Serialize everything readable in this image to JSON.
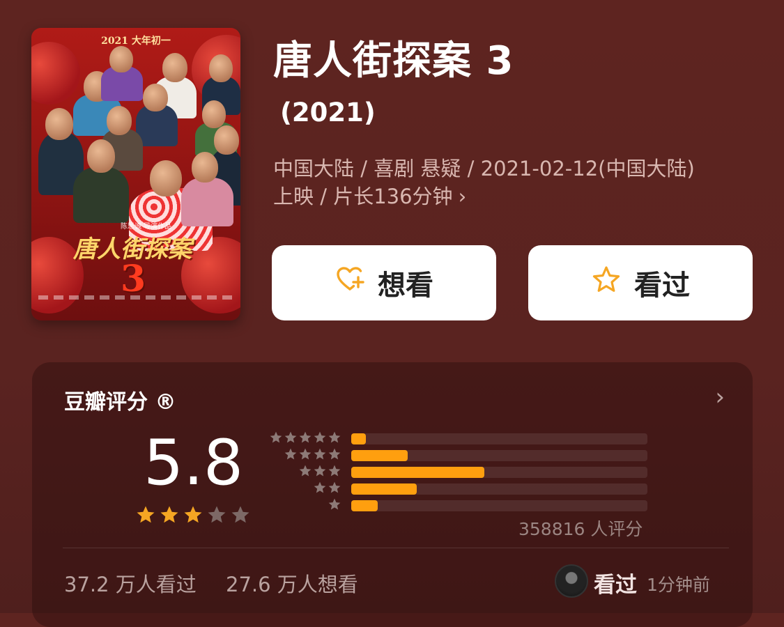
{
  "movie": {
    "poster_top_text": "2021 大年初一",
    "poster_title": "唐人街探案",
    "poster_number": "3",
    "poster_director": "陈思诚 导演作品",
    "title": "唐人街探案 3",
    "year": "(2021)",
    "meta_line1": "中国大陆 / 喜剧 悬疑 / 2021-02-12(中国大陆)",
    "meta_line2": "上映 / 片长136分钟",
    "meta_chevron": "›"
  },
  "actions": {
    "want_label": "想看",
    "want_icon": "heart-plus-icon",
    "seen_label": "看过",
    "seen_icon": "star-outline-icon",
    "accent": "#f5a623"
  },
  "rating": {
    "title": "豆瓣评分 ®",
    "chevron": "›",
    "score": "5.8",
    "stars_filled": 3,
    "stars_total": 5,
    "distribution": [
      {
        "stars": 5,
        "fraction": 0.05
      },
      {
        "stars": 4,
        "fraction": 0.19
      },
      {
        "stars": 3,
        "fraction": 0.45
      },
      {
        "stars": 2,
        "fraction": 0.22
      },
      {
        "stars": 1,
        "fraction": 0.09
      }
    ],
    "bar_color": "#ff9f0f",
    "count_text": "358816 人评分"
  },
  "stats": {
    "seen_text": "37.2 万人看过",
    "want_text": "27.6 万人想看",
    "recent_label": "看过",
    "recent_time": "1分钟前"
  }
}
